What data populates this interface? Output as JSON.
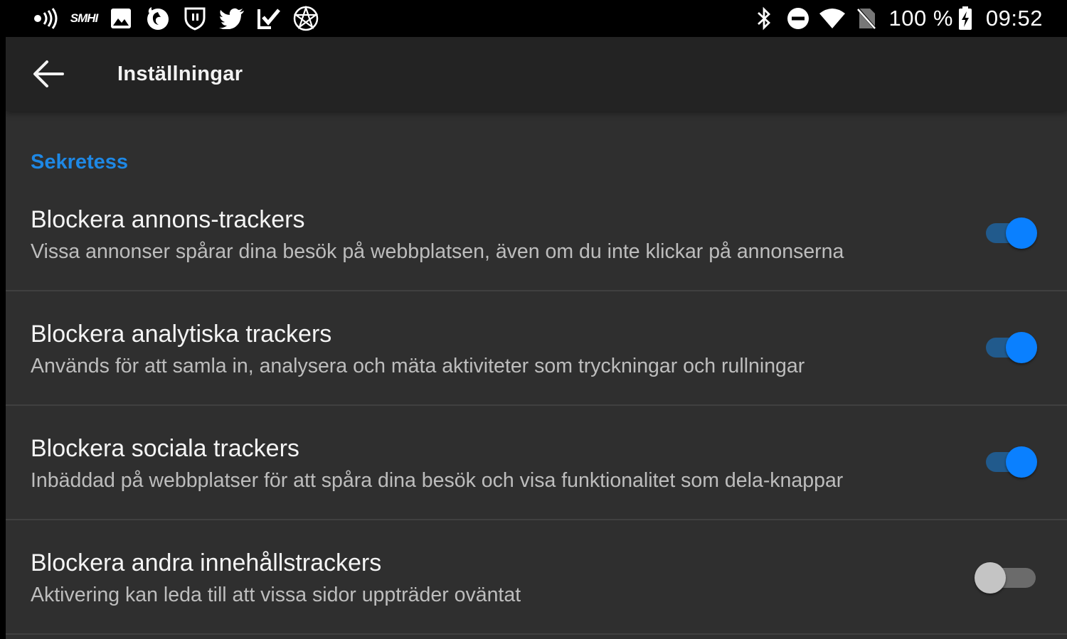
{
  "status_bar": {
    "left_icons": [
      "nfc-signal-icon",
      "smhi-icon",
      "image-icon",
      "firefox-icon",
      "shield-icon",
      "twitter-icon",
      "checkmark-app-icon",
      "pentagram-icon"
    ],
    "smhi_label": "SMHI",
    "right_icons": [
      "bluetooth-icon",
      "do-not-disturb-icon",
      "wifi-icon",
      "no-sim-icon"
    ],
    "battery_percent": "100 %",
    "battery_charging": true,
    "time": "09:52"
  },
  "toolbar": {
    "title": "Inställningar",
    "back_icon": "arrow-left-icon"
  },
  "section": {
    "title": "Sekretess"
  },
  "settings": [
    {
      "title": "Blockera annons-trackers",
      "summary": "Vissa annonser spårar dina besök på webbplatsen, även om du inte klickar på annonserna",
      "enabled": true
    },
    {
      "title": "Blockera analytiska trackers",
      "summary": "Används för att samla in, analysera och mäta aktiviteter som tryckningar och rullningar",
      "enabled": true
    },
    {
      "title": "Blockera sociala trackers",
      "summary": "Inbäddad på webbplatser för att spåra dina besök och visa funktionalitet som dela-knappar",
      "enabled": true
    },
    {
      "title": "Blockera andra innehållstrackers",
      "summary": "Aktivering kan leda till att vissa sidor uppträder oväntat",
      "enabled": false
    }
  ],
  "colors": {
    "accent": "#1e88e5",
    "switch_on_thumb": "#0a80ff",
    "switch_on_track": "#215a8c",
    "switch_off_thumb": "#c4c4c4",
    "switch_off_track": "#6b6b6b",
    "background": "#2f2f2f",
    "toolbar": "#232323"
  }
}
